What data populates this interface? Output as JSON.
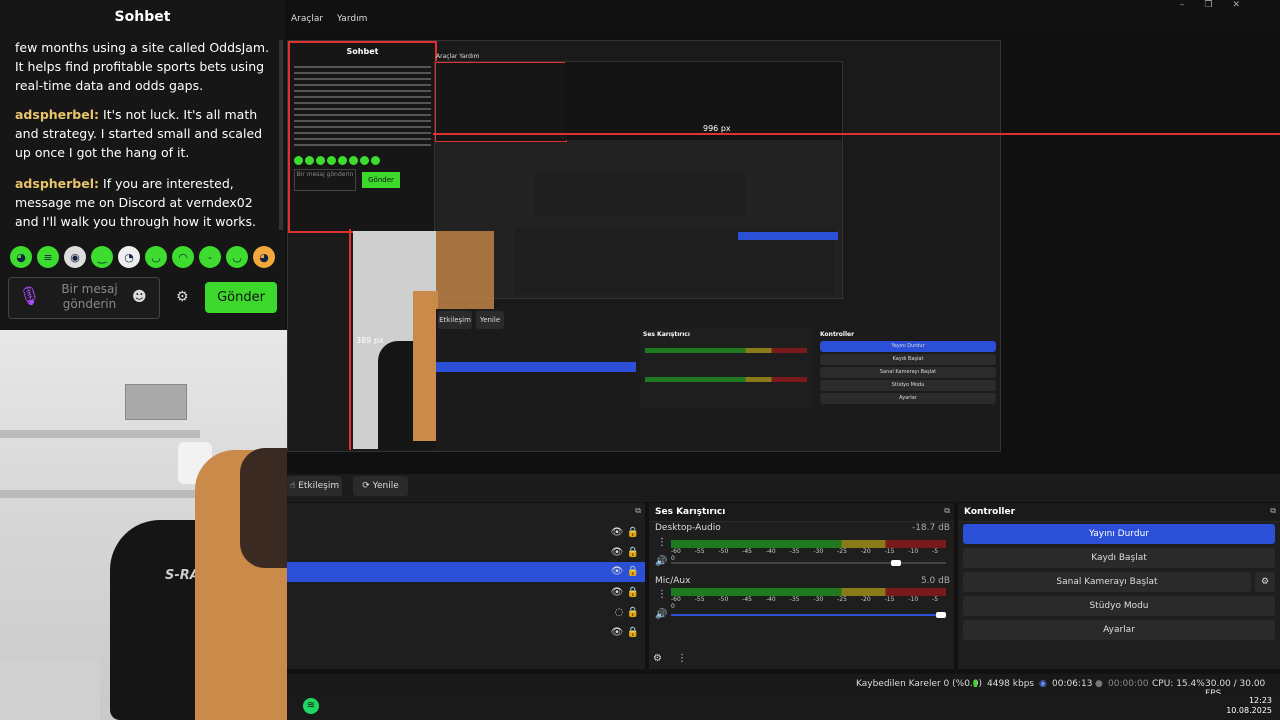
{
  "chat": {
    "title": "Sohbet",
    "messages": [
      {
        "user": "",
        "text": "few months using a site called OddsJam. It helps find profitable sports bets using real-time data and odds gaps."
      },
      {
        "user": "adspherbel:",
        "text": " It's not luck. It's all math and strategy. I started small and scaled up once I got the hang of it."
      },
      {
        "user": "adspherbel:",
        "text": " If you are interested, message me on Discord at verndex02 and I'll walk you through how it works."
      }
    ],
    "input_placeholder": "Bir mesaj gönderin",
    "send_label": "Gönder"
  },
  "menu": {
    "items": [
      "Araçlar",
      "Yardım"
    ]
  },
  "preview": {
    "nested_chat_title": "Sohbet",
    "nested_menu": [
      "Araçlar",
      "Yardım"
    ],
    "nested_send": "Gönder",
    "nested_placeholder": "Bir mesaj gönderin",
    "label_width": "996 px",
    "label_height": "389 px"
  },
  "toolbar": {
    "interact_label": "Etkileşim",
    "refresh_label": "Yenile"
  },
  "mixer": {
    "title": "Ses Karıştırıcı",
    "channels": [
      {
        "name": "Desktop-Audio",
        "db": "-18.7 dB",
        "level": 0.83
      },
      {
        "name": "Mic/Aux",
        "db": "5.0 dB",
        "level": 1.0
      }
    ],
    "scale": [
      "-60",
      "-55",
      "-50",
      "-45",
      "-40",
      "-35",
      "-30",
      "-25",
      "-20",
      "-15",
      "-10",
      "-5",
      "0"
    ]
  },
  "controls": {
    "title": "Kontroller",
    "stop_stream": "Yayını Durdur",
    "start_record": "Kaydı Başlat",
    "virtual_cam": "Sanal Kamerayı Başlat",
    "studio_mode": "Stüdyo Modu",
    "settings": "Ayarlar"
  },
  "status": {
    "dropped": "Kaybedilen Kareler 0 (%0.0)",
    "bitrate": "4498 kbps",
    "stream_time": "00:06:13",
    "record_time": "00:00:00",
    "cpu": "CPU: 15.4%",
    "fps": "30.00 / 30.00 FPS"
  },
  "clock": {
    "time": "12:23",
    "date": "10.08.2025"
  },
  "colors": {
    "accent": "#2b4fd6",
    "send": "#3cd92c",
    "guide": "#e03030"
  }
}
